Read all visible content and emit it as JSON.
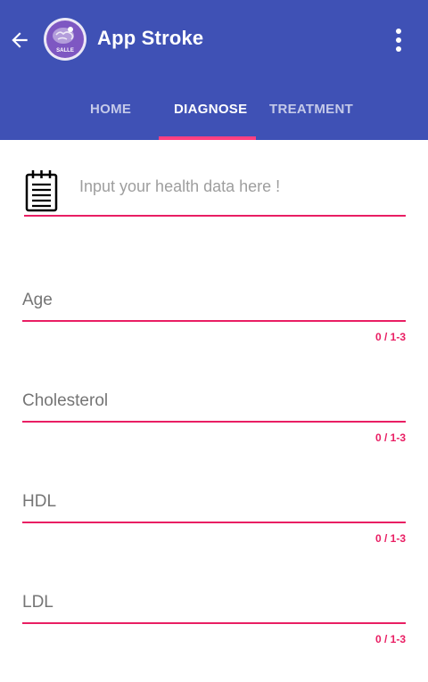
{
  "app": {
    "title": "App Stroke",
    "logo_text": "SALLE"
  },
  "icons": {
    "back": "arrow-back-icon",
    "menu": "more-vert-icon",
    "intro": "notepad-icon"
  },
  "tabs": [
    {
      "label": "HOME",
      "active": false
    },
    {
      "label": "DIAGNOSE",
      "active": true
    },
    {
      "label": "TREATMENT",
      "active": false
    }
  ],
  "intro": {
    "placeholder": "Input your health data here !"
  },
  "fields": [
    {
      "placeholder": "Age",
      "counter": "0 / 1-3"
    },
    {
      "placeholder": "Cholesterol",
      "counter": "0 / 1-3"
    },
    {
      "placeholder": "HDL",
      "counter": "0 / 1-3"
    },
    {
      "placeholder": "LDL",
      "counter": "0 / 1-3"
    }
  ],
  "colors": {
    "primary": "#3f51b5",
    "tab_indicator": "#ff4081",
    "accent": "#e91e63",
    "hint_text": "#757575"
  }
}
